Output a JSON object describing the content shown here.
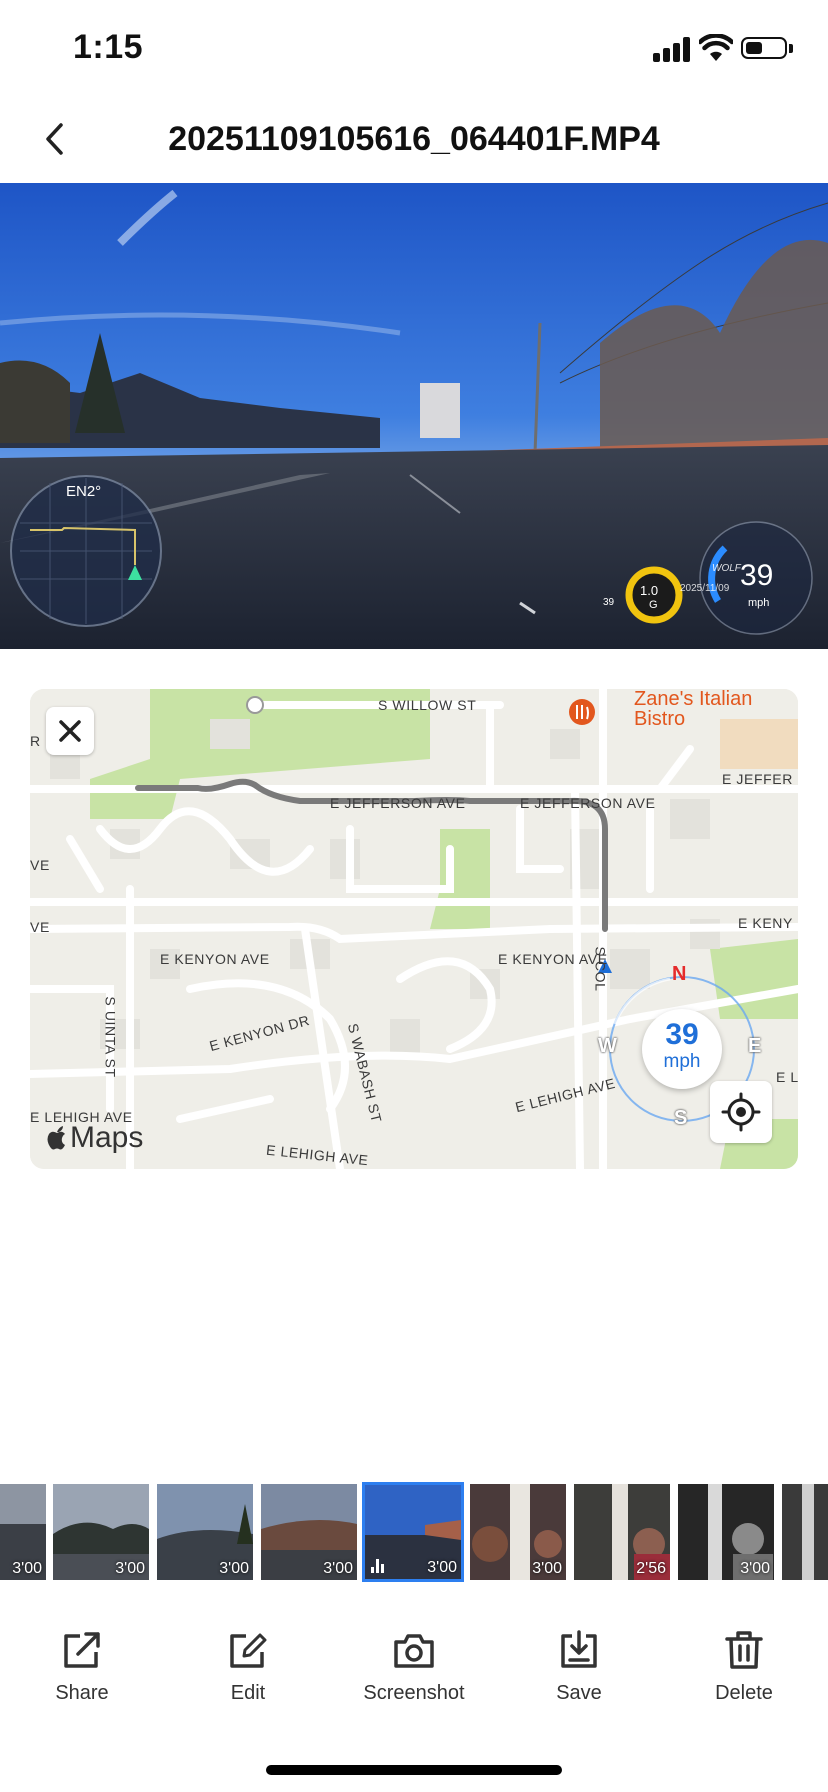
{
  "status_bar": {
    "time": "1:15",
    "battery_level": 0.45
  },
  "header": {
    "title": "20251109105616_064401F.MP4"
  },
  "video": {
    "compass_heading": "EN2°",
    "g_force_value": "1.0",
    "g_force_unit": "G",
    "speed": "39",
    "speed_unit": "mph",
    "watermark": "WOLF",
    "date_overlay": "2025/11/09",
    "small_speed": "39"
  },
  "map": {
    "streets": {
      "willow": "S WILLOW ST",
      "jefferson_1": "E JEFFERSON AVE",
      "jefferson_2": "E JEFFERSON AVE",
      "jefferson_3": "E JEFFER",
      "kenyon_1": "E KENYON AVE",
      "kenyon_2": "E KENYON AVE",
      "kenyon_3": "E KENY",
      "kenyon_dr": "E KENYON DR",
      "uinta": "S UINTA ST",
      "wabash": "S WABASH ST",
      "lehigh_1": "E LEHIGH AVE",
      "lehigh_2": "E LEHIGH AVE",
      "lehigh_3": "E LEHIGH AVE",
      "lehigh_4": "E L",
      "ve_1": "VE",
      "ve_2": "VE",
      "r": "R",
      "cols": "S COL"
    },
    "poi_name": "Zane's Italian Bistro",
    "maps_label": "Maps",
    "speed": "39",
    "speed_unit": "mph",
    "compass": {
      "n": "N",
      "s": "S",
      "e": "E",
      "w": "W"
    }
  },
  "thumbnails": [
    {
      "duration": "3'00",
      "active": false
    },
    {
      "duration": "3'00",
      "active": false
    },
    {
      "duration": "3'00",
      "active": false
    },
    {
      "duration": "3'00",
      "active": false
    },
    {
      "duration": "3'00",
      "active": true
    },
    {
      "duration": "3'00",
      "active": false
    },
    {
      "duration": "2'56",
      "active": false
    },
    {
      "duration": "3'00",
      "active": false
    }
  ],
  "toolbar": {
    "share": "Share",
    "edit": "Edit",
    "screenshot": "Screenshot",
    "save": "Save",
    "delete": "Delete"
  },
  "colors": {
    "accent": "#2d7ff0",
    "route": "#7a7a7a",
    "poi": "#e2571e",
    "map_bg": "#efeee8",
    "park": "#c8e3a5"
  }
}
